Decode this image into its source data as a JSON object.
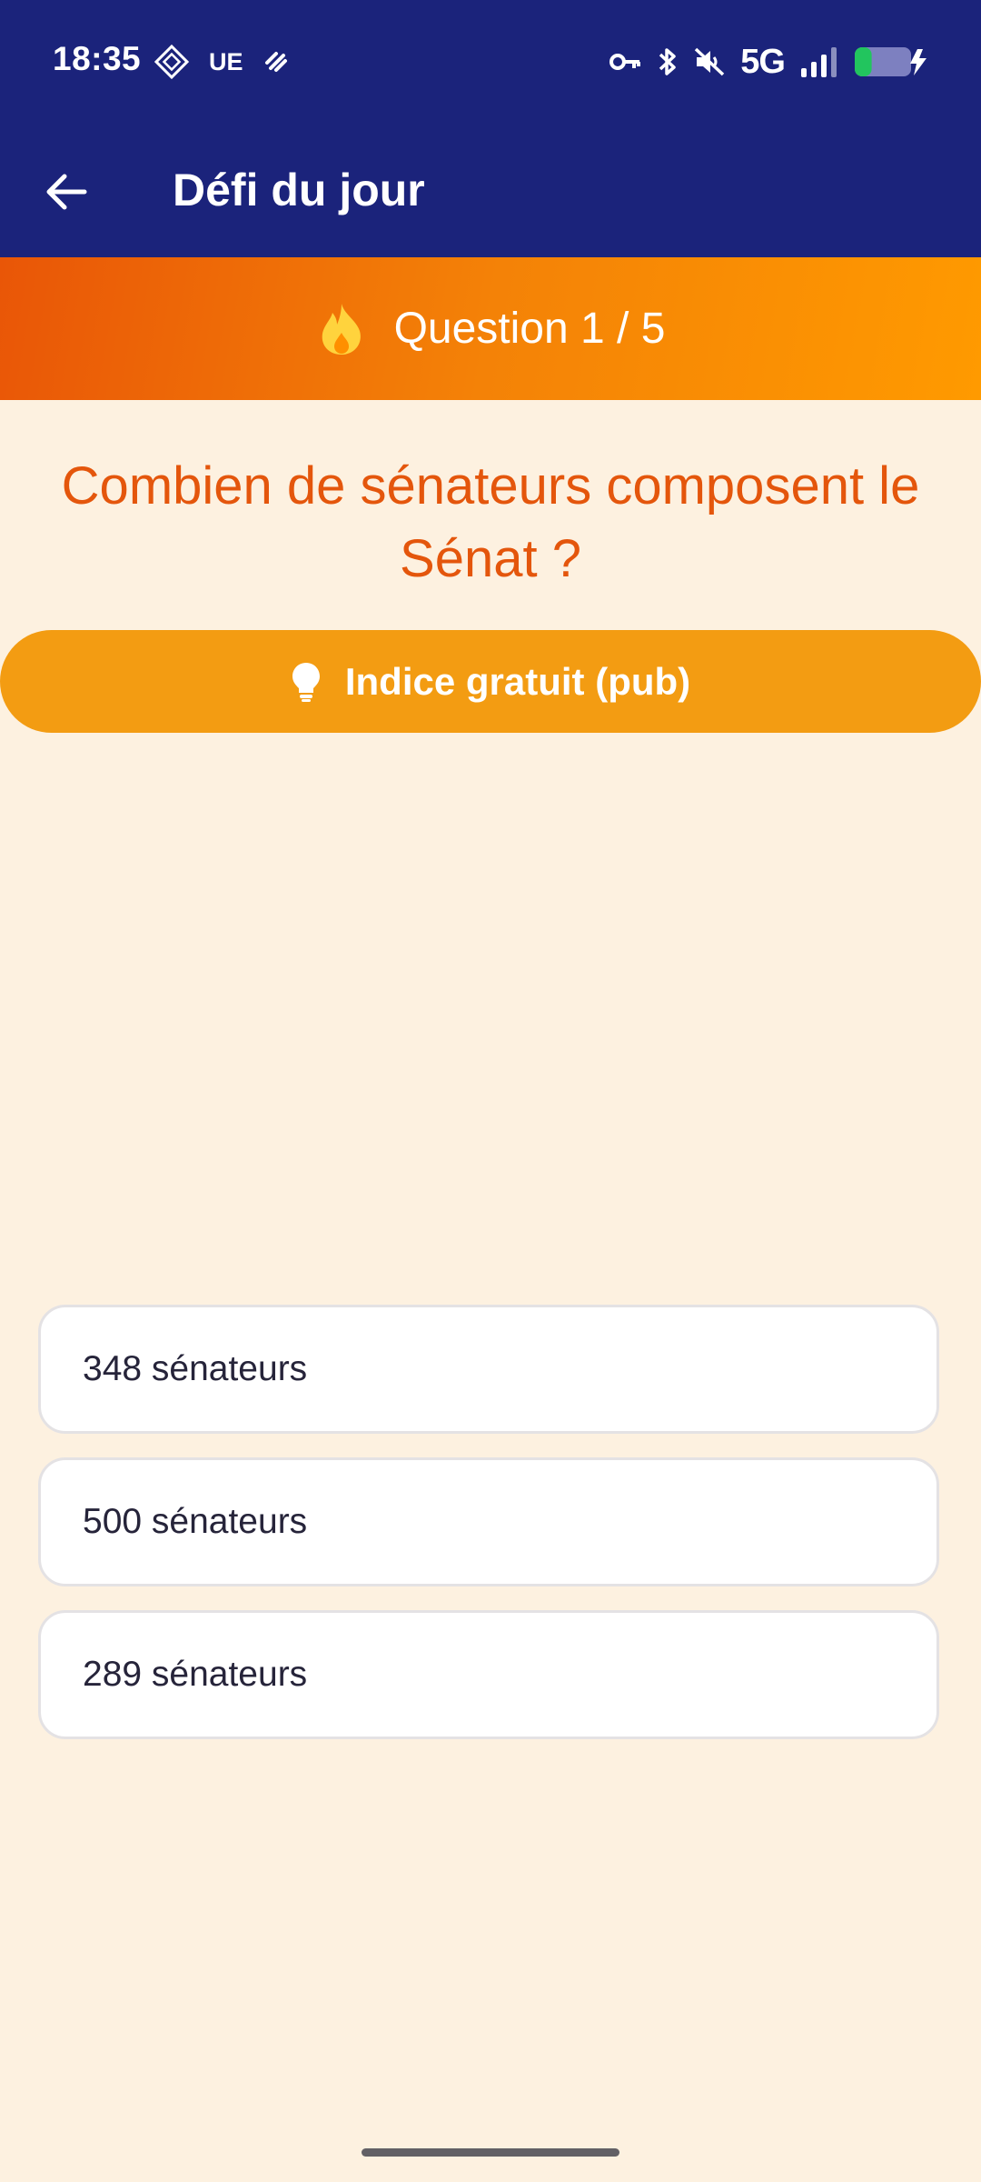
{
  "status_bar": {
    "time": "18:35",
    "carrier_tag": "UE",
    "network": "5G",
    "battery_fill": 0.3,
    "battery_color": "#22c55e",
    "icons": [
      "vpn-icon",
      "ue-label",
      "ubisoft-like-icon",
      "key-icon",
      "bluetooth-icon",
      "mute-icon",
      "signal-icon",
      "battery-charging-icon"
    ]
  },
  "app_bar": {
    "title": "Défi du jour",
    "back_icon": "arrow-left-icon",
    "background": "#1b237b"
  },
  "progress": {
    "label": "Question 1 / 5",
    "icon": "fire-icon",
    "current": 1,
    "total": 5
  },
  "question": {
    "text": "Combien de sénateurs composent le Sénat ?",
    "color": "#e4560c"
  },
  "hint": {
    "label": "Indice gratuit (pub)",
    "icon": "lightbulb-icon",
    "color": "#f39c12"
  },
  "answers": [
    {
      "label": "348 sénateurs"
    },
    {
      "label": "500 sénateurs"
    },
    {
      "label": "289 sénateurs"
    }
  ],
  "theme": {
    "background": "#fdf1e0",
    "banner_gradient": [
      "#e95607",
      "#ff9a00"
    ]
  }
}
